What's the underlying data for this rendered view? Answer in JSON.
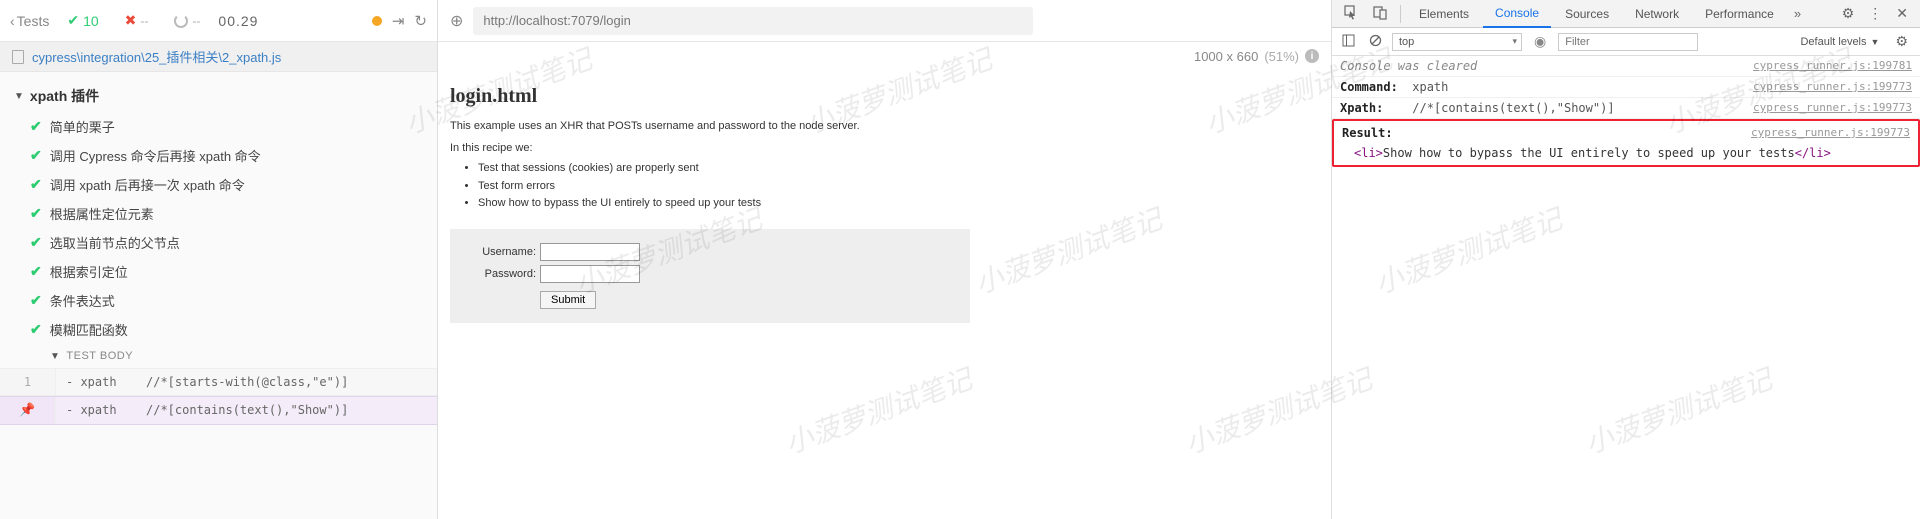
{
  "watermark": "小菠萝测试笔记",
  "left": {
    "tests_label": "Tests",
    "pass_count": "10",
    "fail_count": "--",
    "pending_count": "--",
    "timer": "00.29",
    "file_path": "cypress\\integration\\25_插件相关\\2_xpath.js",
    "suite_title": "xpath 插件",
    "tests": [
      "简单的栗子",
      "调用 Cypress 命令后再接 xpath 命令",
      "调用 xpath 后再接一次 xpath 命令",
      "根据属性定位元素",
      "选取当前节点的父节点",
      "根据索引定位",
      "条件表达式",
      "模糊匹配函数"
    ],
    "section_label": "TEST BODY",
    "commands": [
      {
        "num": "1",
        "pinned": false,
        "name": "- xpath",
        "msg": "//*[starts-with(@class,\"e\")]"
      },
      {
        "num": "",
        "pinned": true,
        "name": "- xpath",
        "msg": "//*[contains(text(),\"Show\")]"
      }
    ]
  },
  "mid": {
    "url": "http://localhost:7079/login",
    "viewport_size": "1000 x 660",
    "scale": "(51%)",
    "app": {
      "title": "login.html",
      "desc": "This example uses an XHR that POSTs username and password to the node server.",
      "subhead": "In this recipe we:",
      "bullets": [
        "Test that sessions (cookies) are properly sent",
        "Test form errors",
        "Show how to bypass the UI entirely to speed up your tests"
      ],
      "label_user": "Username:",
      "label_pass": "Password:",
      "btn_submit": "Submit"
    }
  },
  "right": {
    "tabs": [
      "Elements",
      "Console",
      "Sources",
      "Network",
      "Performance"
    ],
    "active_tab": "Console",
    "context": "top",
    "filter_placeholder": "Filter",
    "levels": "Default levels",
    "console": {
      "cleared": "Console was cleared",
      "rows": [
        {
          "key": "Command:",
          "val": "xpath",
          "src": "cypress_runner.js:199773"
        },
        {
          "key": "Xpath:",
          "val": "//*[contains(text(),\"Show\")]",
          "src": "cypress_runner.js:199773"
        }
      ],
      "result_key": "Result:",
      "result_src": "cypress_runner.js:199773",
      "result_tag_open": "<li>",
      "result_text": "Show how to bypass the UI entirely to speed up your tests",
      "result_tag_close": "</li>",
      "cleared_src": "cypress_runner.js:199781"
    }
  }
}
